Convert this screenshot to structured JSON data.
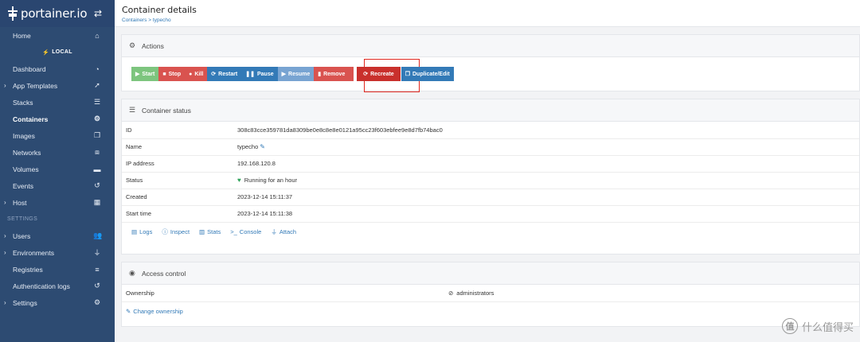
{
  "brand": {
    "name": "portainer.io",
    "swap_icon": "⇄"
  },
  "sidebar": {
    "items_top": [
      {
        "label": "Home",
        "icon": "⌂",
        "icon_name": "home-icon"
      }
    ],
    "environment": "LOCAL",
    "env_icon": "⚡",
    "items_env": [
      {
        "label": "Dashboard",
        "icon": "◔",
        "icon_name": "dashboard-icon",
        "caret": ""
      },
      {
        "label": "App Templates",
        "icon": "➚",
        "icon_name": "rocket-icon",
        "caret": "›"
      },
      {
        "label": "Stacks",
        "icon": "☰",
        "icon_name": "stack-list-icon",
        "caret": ""
      },
      {
        "label": "Containers",
        "icon": "⚙",
        "icon_name": "cubes-icon",
        "caret": "",
        "active": true
      },
      {
        "label": "Images",
        "icon": "❐",
        "icon_name": "clone-icon",
        "caret": ""
      },
      {
        "label": "Networks",
        "icon": "⧈",
        "icon_name": "sitemap-icon",
        "caret": ""
      },
      {
        "label": "Volumes",
        "icon": "▬",
        "icon_name": "hdd-icon",
        "caret": ""
      },
      {
        "label": "Events",
        "icon": "↺",
        "icon_name": "history-icon",
        "caret": ""
      },
      {
        "label": "Host",
        "icon": "▦",
        "icon_name": "grid-icon",
        "caret": "›"
      }
    ],
    "settings_section": "SETTINGS",
    "items_settings": [
      {
        "label": "Users",
        "icon": "👥",
        "icon_name": "users-icon",
        "caret": "›"
      },
      {
        "label": "Environments",
        "icon": "⏚",
        "icon_name": "plug-icon",
        "caret": "›"
      },
      {
        "label": "Registries",
        "icon": "≡",
        "icon_name": "database-icon",
        "caret": ""
      },
      {
        "label": "Authentication logs",
        "icon": "↺",
        "icon_name": "history-icon",
        "caret": ""
      },
      {
        "label": "Settings",
        "icon": "⚙",
        "icon_name": "cogs-icon",
        "caret": "›"
      }
    ]
  },
  "header": {
    "title": "Container details",
    "breadcrumb": "Containers > typecho"
  },
  "actions": {
    "title": "Actions",
    "buttons": {
      "start": "Start",
      "stop": "Stop",
      "kill": "Kill",
      "restart": "Restart",
      "pause": "Pause",
      "resume": "Resume",
      "remove": "Remove",
      "recreate": "Recreate",
      "duplicate": "Duplicate/Edit"
    }
  },
  "status": {
    "title": "Container status",
    "rows": [
      {
        "key": "ID",
        "value": "308c83cce359781da8309be0e8c8e8e0121a95cc23f603ebfee9e8d7fb74bac0"
      },
      {
        "key": "Name",
        "value": "typecho"
      },
      {
        "key": "IP address",
        "value": "192.168.120.8"
      },
      {
        "key": "Status",
        "value": "Running for an hour"
      },
      {
        "key": "Created",
        "value": "2023-12-14 15:11:37"
      },
      {
        "key": "Start time",
        "value": "2023-12-14 15:11:38"
      }
    ],
    "links": [
      "Logs",
      "Inspect",
      "Stats",
      "Console",
      "Attach"
    ]
  },
  "access": {
    "title": "Access control",
    "ownership_label": "Ownership",
    "ownership_value": "administrators",
    "change_link": "Change ownership"
  },
  "watermark": {
    "text": "什么值得买",
    "logo": "值"
  },
  "colors": {
    "sidebar": "#2d4b72",
    "primary": "#337ab7",
    "danger": "#d9534f",
    "success": "#7dc57e",
    "highlight": "#e0281f"
  }
}
